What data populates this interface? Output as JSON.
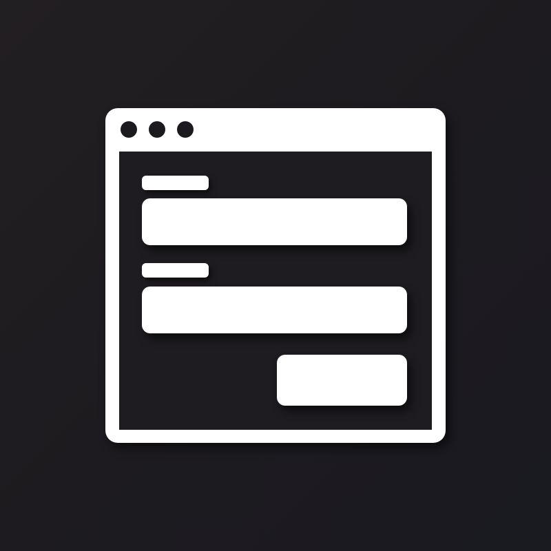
{
  "window": {
    "title_bar_controls": [
      "window-control-dot",
      "window-control-dot",
      "window-control-dot"
    ]
  },
  "form": {
    "fields": [
      {
        "label": "",
        "value": ""
      },
      {
        "label": "",
        "value": ""
      }
    ],
    "submit_label": ""
  },
  "colors": {
    "background": "#1e1c20",
    "foreground": "#ffffff"
  }
}
